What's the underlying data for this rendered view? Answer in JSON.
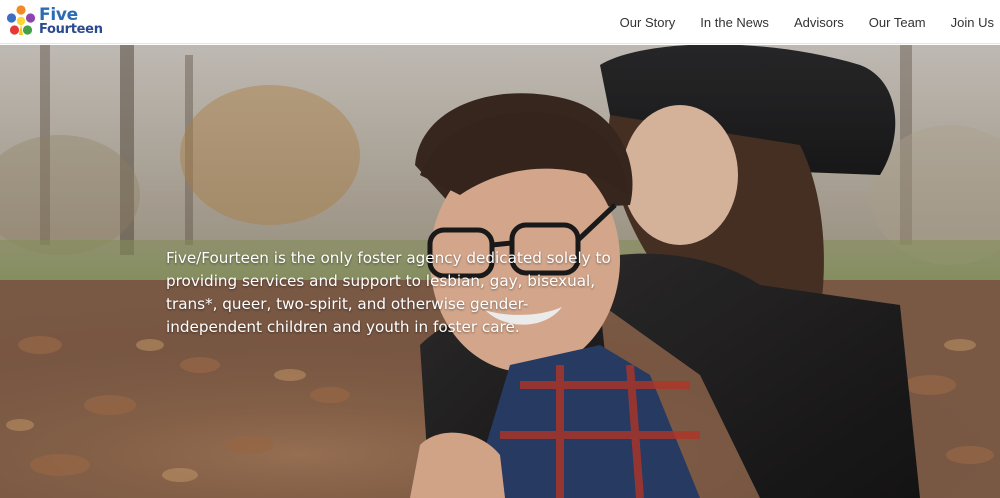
{
  "header": {
    "logo": {
      "line1": "Five",
      "line2": "Fourteen",
      "icon": "five-fourteen-flower-logo"
    },
    "nav": [
      {
        "label": "Our Story"
      },
      {
        "label": "In the News"
      },
      {
        "label": "Advisors"
      },
      {
        "label": "Our Team"
      },
      {
        "label": "Join Us"
      }
    ]
  },
  "hero": {
    "tagline": "Five/Fourteen is the only foster agency dedicated solely to providing services and support to lesbian, gay, bisexual, trans*, queer, two-spirit, and otherwise gender-independent children and youth in foster care.",
    "image": "photo of two young people embracing in autumn leaves"
  },
  "colors": {
    "logo_blue": "#2b6cb3",
    "logo_navy": "#2b4a8f",
    "nav_text": "#333333",
    "hero_text": "#ffffff"
  }
}
